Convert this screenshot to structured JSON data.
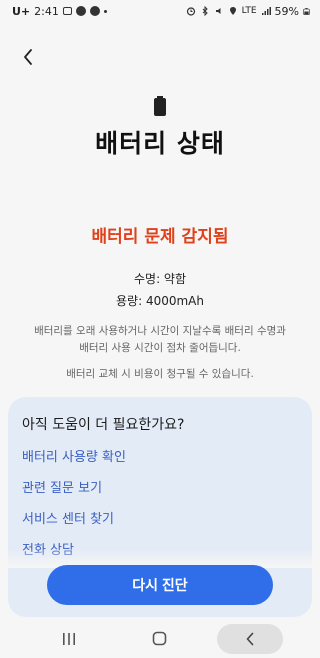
{
  "status_bar": {
    "carrier": "U+",
    "time": "2:41",
    "network": "LTE",
    "battery_percent": "59%"
  },
  "header": {
    "title": "배터리 상태",
    "back_icon": "chevron-left-icon"
  },
  "status": {
    "alert": "배터리 문제 감지됨",
    "lifespan": "수명: 약함",
    "capacity": "용량: 4000mAh",
    "description": "배터리를 오래 사용하거나 시간이 지날수록 배터리 수명과 배터리 사용 시간이 점차 줄어듭니다.",
    "cost_note": "배터리 교체 시 비용이 청구될 수 있습니다."
  },
  "help": {
    "title": "아직 도움이 더 필요한가요?",
    "links": [
      "배터리 사용량 확인",
      "관련 질문 보기",
      "서비스 센터 찾기",
      "전화 상담"
    ]
  },
  "actions": {
    "primary": "다시 진단"
  },
  "colors": {
    "alert": "#e0411b",
    "link": "#3a5fc4",
    "primary_button": "#2f6ee8",
    "card_bg": "#e3ebf7"
  }
}
